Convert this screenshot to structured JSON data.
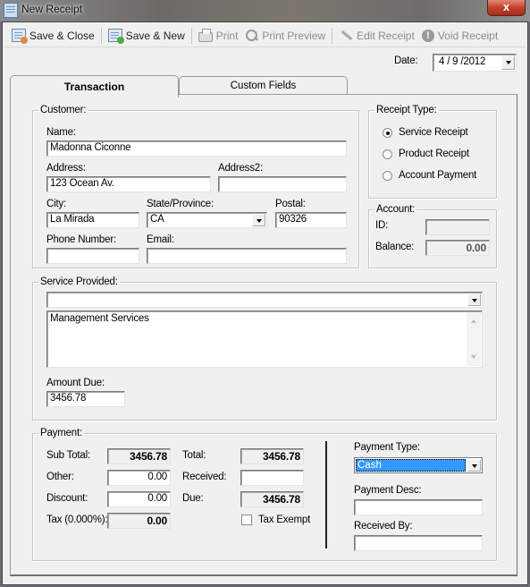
{
  "window": {
    "title": "New Receipt",
    "close_label": "x"
  },
  "toolbar": {
    "save_close": "Save & Close",
    "save_new": "Save & New",
    "print": "Print",
    "print_preview": "Print Preview",
    "edit_receipt": "Edit Receipt",
    "void_receipt": "Void Receipt"
  },
  "date": {
    "label": "Date:",
    "value": "4 / 9 /2012"
  },
  "tabs": [
    {
      "label": "Transaction",
      "active": true
    },
    {
      "label": "Custom Fields",
      "active": false
    }
  ],
  "customer": {
    "legend": "Customer:",
    "name_label": "Name:",
    "name": "Madonna Ciconne",
    "address_label": "Address:",
    "address": "123 Ocean Av.",
    "address2_label": "Address2:",
    "address2": "",
    "city_label": "City:",
    "city": "La Mirada",
    "state_label": "State/Province:",
    "state": "CA",
    "postal_label": "Postal:",
    "postal": "90326",
    "phone_label": "Phone Number:",
    "phone": "",
    "email_label": "Email:",
    "email": ""
  },
  "receipt_type": {
    "legend": "Receipt Type:",
    "options": [
      "Service Receipt",
      "Product Receipt",
      "Account Payment"
    ],
    "selected": "Service Receipt"
  },
  "account": {
    "legend": "Account:",
    "id_label": "ID:",
    "id": "",
    "balance_label": "Balance:",
    "balance": "0.00"
  },
  "service": {
    "legend": "Service Provided:",
    "combo_value": "",
    "description": "Management Services",
    "amount_due_label": "Amount Due:",
    "amount_due": "3456.78"
  },
  "payment": {
    "legend": "Payment:",
    "subtotal_label": "Sub Total:",
    "subtotal": "3456.78",
    "other_label": "Other:",
    "other": "0.00",
    "discount_label": "Discount:",
    "discount": "0.00",
    "tax_label": "Tax (0.000%):",
    "tax": "0.00",
    "total_label": "Total:",
    "total": "3456.78",
    "received_label": "Received:",
    "received": "",
    "due_label": "Due:",
    "due": "3456.78",
    "tax_exempt_label": "Tax Exempt",
    "tax_exempt": false,
    "payment_type_label": "Payment Type:",
    "payment_type": "Cash",
    "payment_desc_label": "Payment Desc:",
    "payment_desc": "",
    "received_by_label": "Received By:",
    "received_by": ""
  }
}
